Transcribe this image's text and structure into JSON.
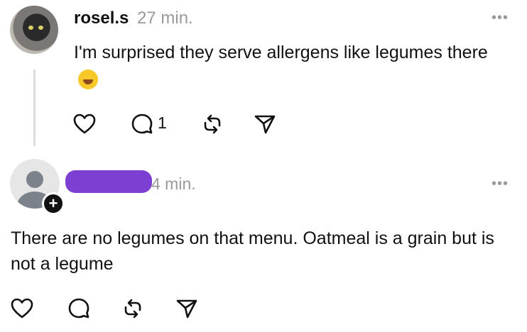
{
  "post1": {
    "username": "rosel.s",
    "time": "27 min.",
    "body": "I'm surprised they serve allergens like legumes there",
    "emoji": "rolling-on-floor-laughing",
    "reply_count": "1",
    "more": "•••"
  },
  "post2": {
    "time": "4 min.",
    "body": "There are no legumes on that menu. Oatmeal is a grain but is not a legume",
    "follow_glyph": "+",
    "more": "•••"
  },
  "colors": {
    "redaction": "#7c3fd2",
    "muted_text": "#9a9a9a",
    "thread_line": "#dcdcdc"
  }
}
